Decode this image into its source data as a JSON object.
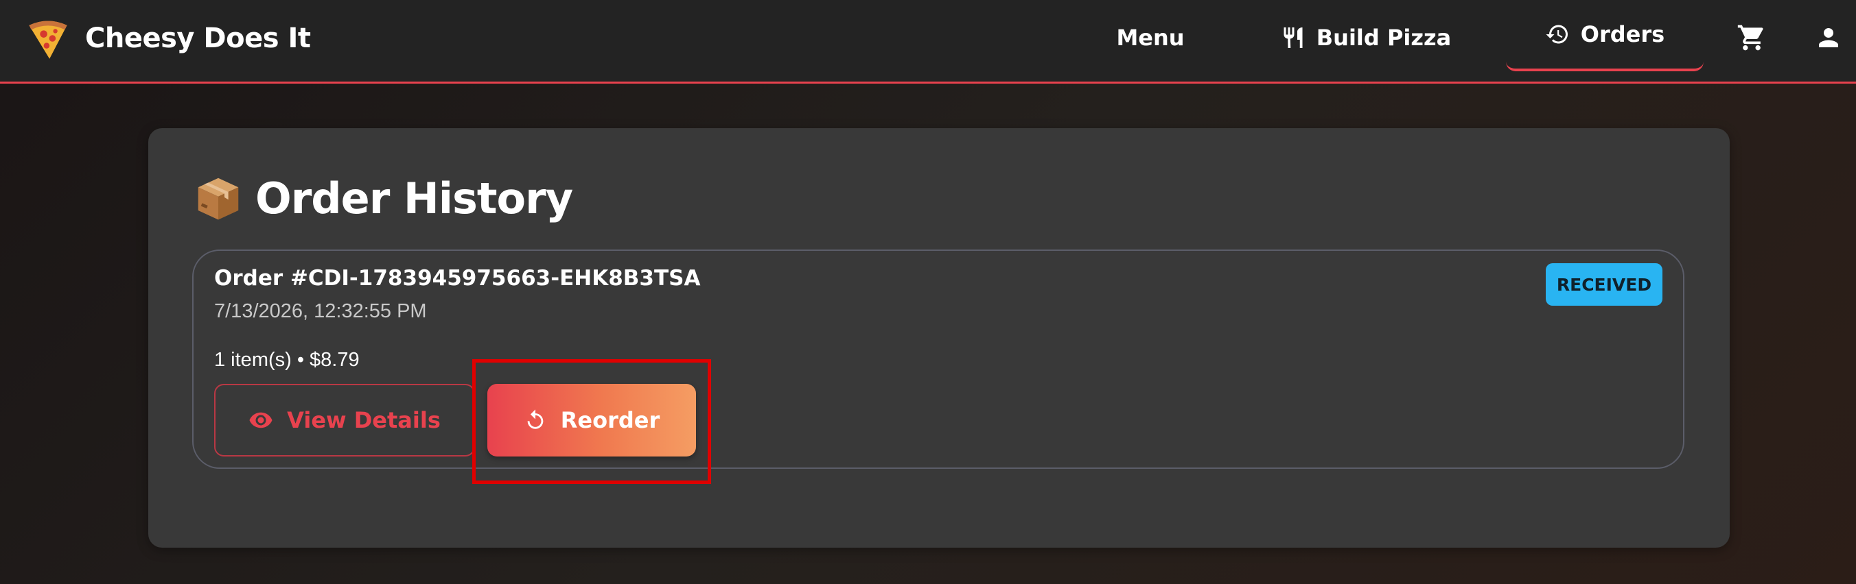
{
  "navbar": {
    "brand_title": "Cheesy Does It",
    "brand_icon": "pizza-slice-icon",
    "items": {
      "menu": "Menu",
      "build_pizza": "Build Pizza",
      "orders": "Orders"
    },
    "icons": {
      "build_pizza": "fork-knife-icon",
      "orders": "history-icon",
      "cart": "cart-icon",
      "account": "account-icon"
    },
    "accent_color": "#e8424e"
  },
  "main": {
    "title": "Order History",
    "title_icon": "package-box-icon",
    "orders": [
      {
        "number": "Order #CDI-1783945975663-EHK8B3TSA",
        "date": "7/13/2026, 12:32:55 PM",
        "summary": "1 item(s) • $8.79",
        "status": "RECEIVED",
        "status_color": "#29b4f2",
        "actions": {
          "view_details": "View Details",
          "view_details_icon": "eye-icon",
          "reorder": "Reorder",
          "reorder_icon": "reorder-icon"
        }
      }
    ]
  }
}
